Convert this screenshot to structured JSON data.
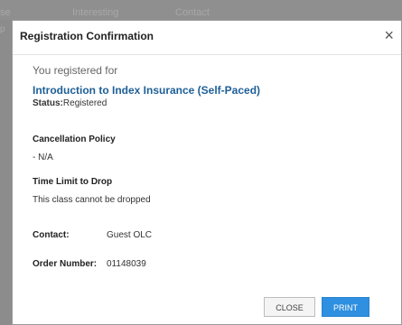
{
  "backdrop": {
    "fragment1": "se",
    "fragment2": "Interesting",
    "fragment3": "Contact",
    "left_fragment": "p"
  },
  "modal": {
    "title": "Registration Confirmation",
    "close_symbol": "×",
    "registered_label": "You registered for",
    "course_title": "Introduction to Index Insurance (Self-Paced)",
    "status_label": "Status:",
    "status_value": "Registered",
    "cancellation_heading": "Cancellation Policy",
    "cancellation_value": "- N/A",
    "time_limit_heading": "Time Limit to Drop",
    "time_limit_value": "This class cannot be dropped",
    "contact_label": "Contact:",
    "contact_value": "Guest OLC",
    "order_label": "Order Number:",
    "order_value": "01148039",
    "close_button": "CLOSE",
    "print_button": "PRINT"
  },
  "colors": {
    "accent": "#2f8fe0",
    "course_title": "#1f5f96"
  }
}
